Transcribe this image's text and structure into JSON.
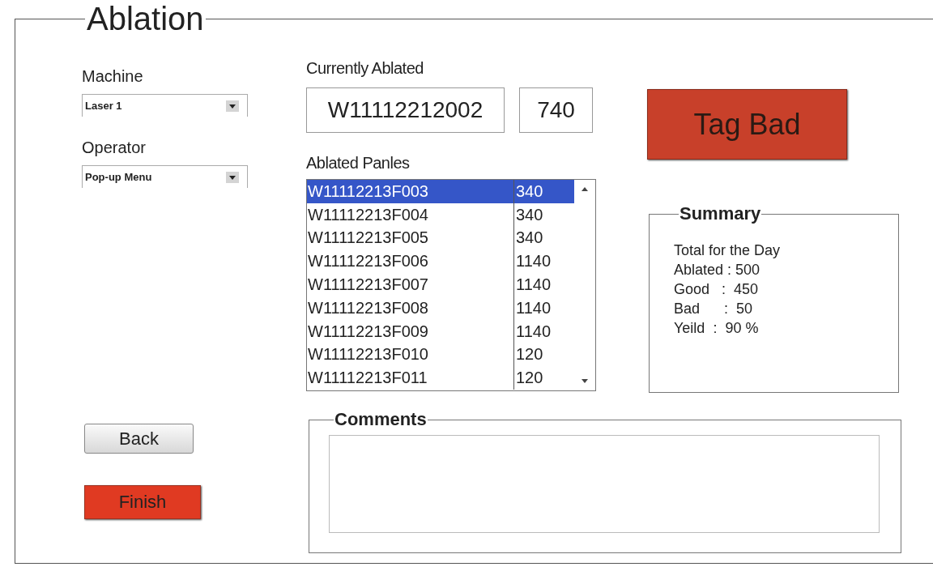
{
  "window": {
    "title": "Ablation"
  },
  "machine": {
    "label": "Machine",
    "value": "Laser 1"
  },
  "operator": {
    "label": "Operator",
    "value": "Pop-up Menu"
  },
  "currently_ablated": {
    "label": "Currently Ablated",
    "panel": "W11112212002",
    "count": "740"
  },
  "tag_bad_button": "Tag Bad",
  "ablated_panels": {
    "label": "Ablated Panles",
    "rows": [
      {
        "panel": "W11112213F003",
        "count": "340",
        "selected": true
      },
      {
        "panel": "W11112213F004",
        "count": "340",
        "selected": false
      },
      {
        "panel": "W11112213F005",
        "count": "340",
        "selected": false
      },
      {
        "panel": "W11112213F006",
        "count": "1140",
        "selected": false
      },
      {
        "panel": "W11112213F007",
        "count": "1140",
        "selected": false
      },
      {
        "panel": "W11112213F008",
        "count": "1140",
        "selected": false
      },
      {
        "panel": "W11112213F009",
        "count": "1140",
        "selected": false
      },
      {
        "panel": "W11112213F010",
        "count": "120",
        "selected": false
      },
      {
        "panel": "W11112213F011",
        "count": "120",
        "selected": false
      }
    ]
  },
  "summary": {
    "title": "Summary",
    "lines": [
      "Total for the Day",
      "Ablated : 500",
      "Good   :  450",
      "Bad      :  50",
      "Yeild  :  90 %"
    ]
  },
  "buttons": [
    {
      "label": "Back",
      "kind": "plain"
    },
    {
      "label": "Finish",
      "kind": "danger"
    }
  ],
  "comments": {
    "title": "Comments"
  }
}
